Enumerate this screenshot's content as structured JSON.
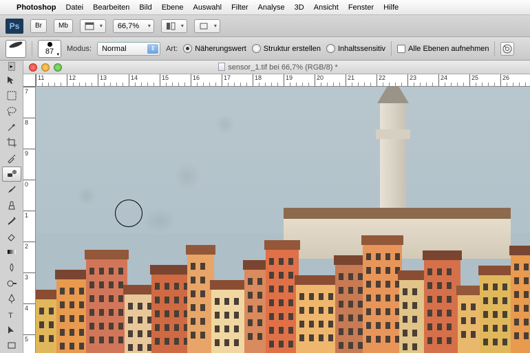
{
  "menubar": {
    "app": "Photoshop",
    "items": [
      "Datei",
      "Bearbeiten",
      "Bild",
      "Ebene",
      "Auswahl",
      "Filter",
      "Analyse",
      "3D",
      "Ansicht",
      "Fenster",
      "Hilfe"
    ]
  },
  "optbar1": {
    "br": "Br",
    "mb": "Mb",
    "zoom": "66,7%"
  },
  "optbar2": {
    "brush_size": "87",
    "modus_label": "Modus:",
    "modus_value": "Normal",
    "art_label": "Art:",
    "radio1": "Näherungswert",
    "radio2": "Struktur erstellen",
    "radio3": "Inhaltssensitiv",
    "sample_all": "Alle Ebenen aufnehmen"
  },
  "document": {
    "title": "sensor_1.tif bei 66,7% (RGB/8) *"
  },
  "ruler_h": [
    "11",
    "12",
    "13",
    "14",
    "15",
    "16",
    "17",
    "18",
    "19",
    "20",
    "21",
    "22",
    "23",
    "24",
    "25",
    "26"
  ],
  "ruler_v": [
    "7",
    "8",
    "9",
    "0",
    "1",
    "2",
    "3",
    "4",
    "5"
  ]
}
